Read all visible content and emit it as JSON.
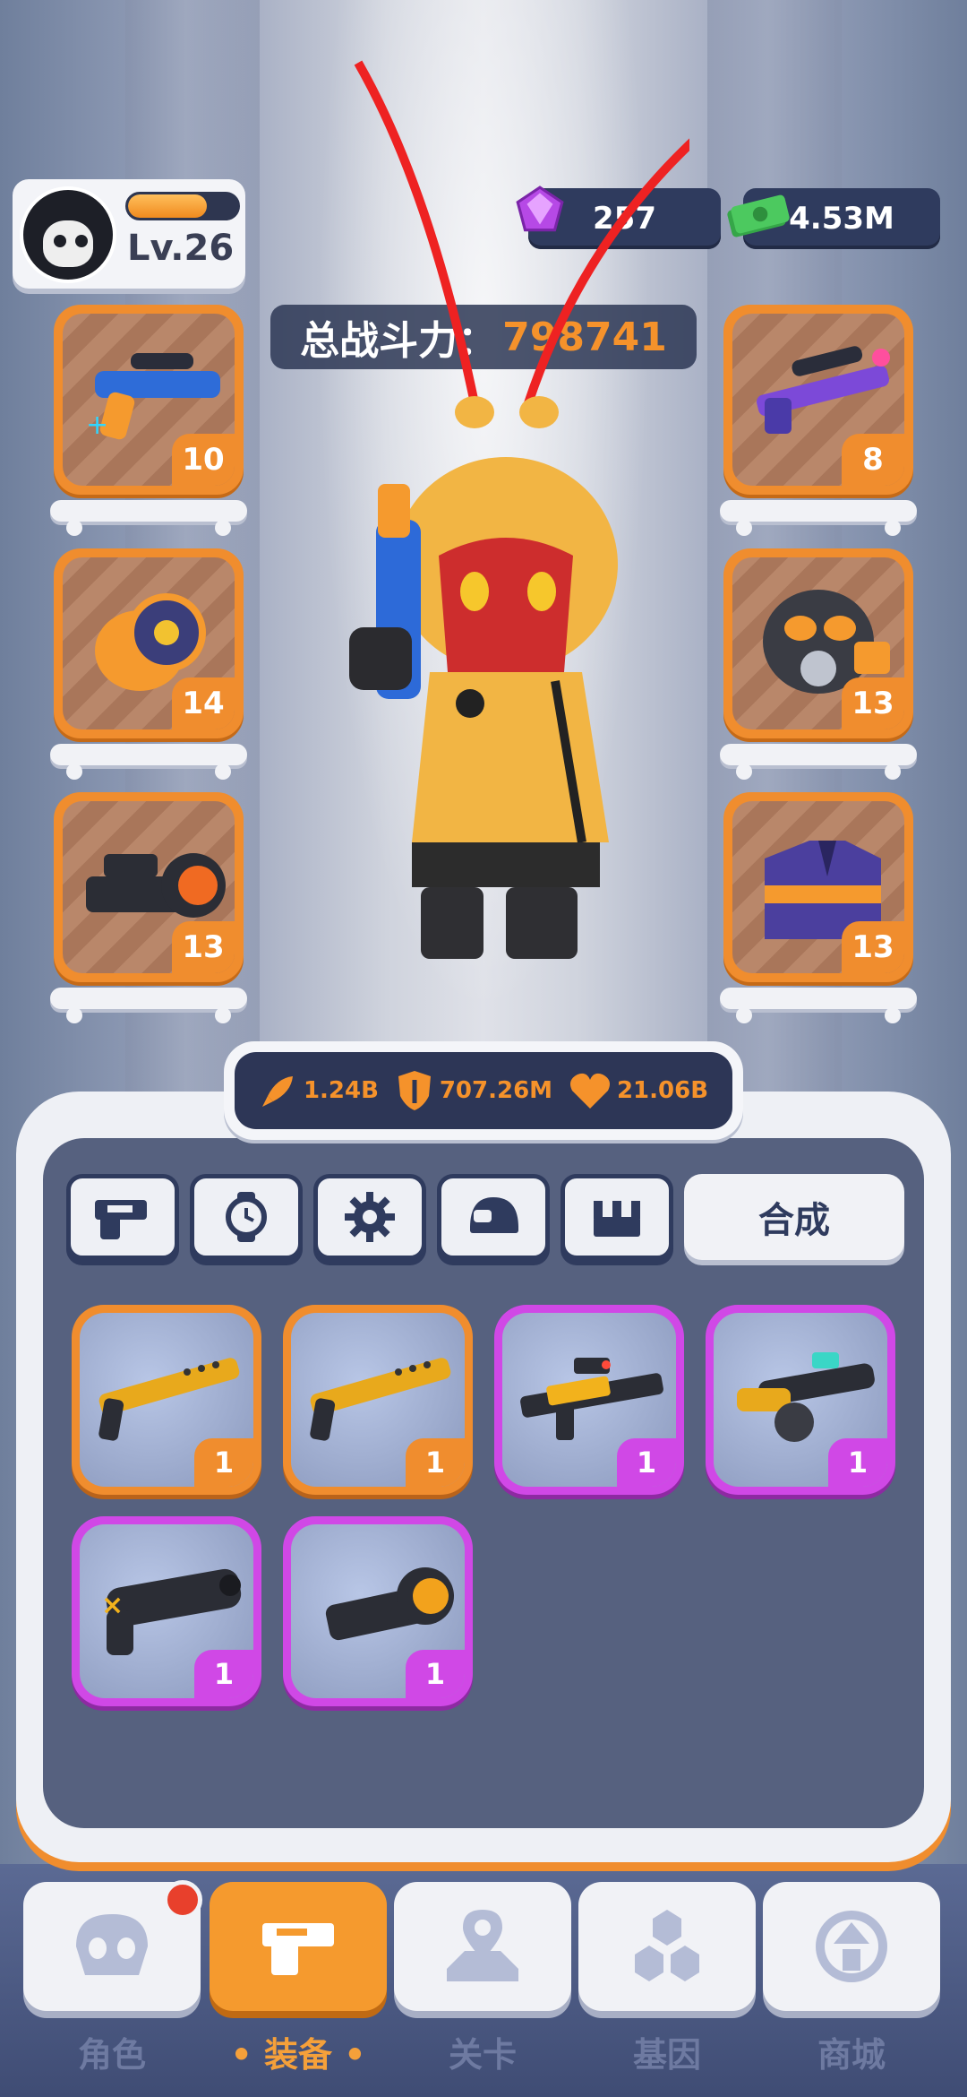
{
  "player": {
    "level": "Lv.26",
    "xp_fraction": 0.72
  },
  "currency": {
    "gems": "257",
    "cash": "4.53M"
  },
  "power": {
    "label": "总战斗力：",
    "value": "798741"
  },
  "equip_left": [
    {
      "name": "blaster",
      "level": "10"
    },
    {
      "name": "bracer",
      "level": "14"
    },
    {
      "name": "scope",
      "level": "13"
    }
  ],
  "equip_right": [
    {
      "name": "sniper",
      "level": "8"
    },
    {
      "name": "gas-mask",
      "level": "13"
    },
    {
      "name": "jacket",
      "level": "13"
    }
  ],
  "stats": {
    "attack": "1.24B",
    "defense": "707.26M",
    "health": "21.06B"
  },
  "tabs": {
    "merge_label": "合成"
  },
  "inventory": [
    {
      "rarity": "orange",
      "count": "1"
    },
    {
      "rarity": "orange",
      "count": "1"
    },
    {
      "rarity": "purple",
      "count": "1"
    },
    {
      "rarity": "purple",
      "count": "1"
    },
    {
      "rarity": "purple",
      "count": "1"
    },
    {
      "rarity": "purple",
      "count": "1"
    }
  ],
  "nav": [
    {
      "label": "角色"
    },
    {
      "label": "• 装备 •"
    },
    {
      "label": "关卡"
    },
    {
      "label": "基因"
    },
    {
      "label": "商城"
    }
  ],
  "colors": {
    "accent_orange": "#f08d2e",
    "rare_purple": "#d048e6",
    "navy": "#2f3b5e"
  }
}
